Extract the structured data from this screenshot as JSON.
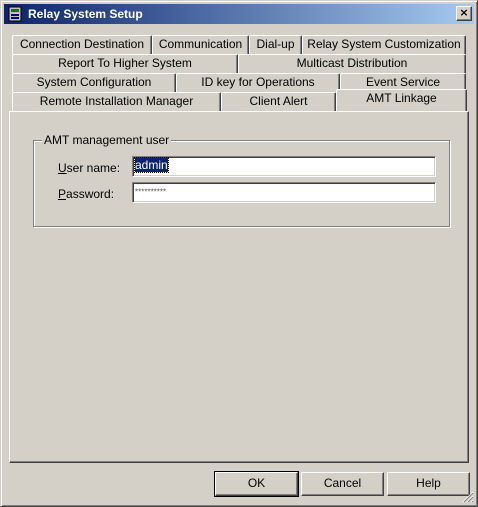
{
  "window": {
    "title": "Relay System Setup",
    "close_label": "×"
  },
  "tabs": {
    "row1": [
      "Connection Destination",
      "Communication",
      "Dial-up",
      "Relay System Customization"
    ],
    "row2": [
      "Report To Higher System",
      "Multicast Distribution"
    ],
    "row3": [
      "System Configuration",
      "ID key for Operations",
      "Event Service"
    ],
    "row4": [
      "Remote Installation Manager",
      "Client Alert",
      "AMT Linkage"
    ],
    "active": "AMT Linkage"
  },
  "group": {
    "legend": "AMT management user",
    "username_label_underlined": "U",
    "username_label_rest": "ser name:",
    "username_value": "admin",
    "password_label_underlined": "P",
    "password_label_rest": "assword:",
    "password_value": "**********"
  },
  "buttons": {
    "ok": "OK",
    "cancel": "Cancel",
    "help": "Help"
  },
  "colors": {
    "title_gradient_start": "#0a246a",
    "title_gradient_end": "#a6caf0",
    "face": "#d4d0c8",
    "selection": "#0a246a"
  },
  "icons": {
    "app": "relay-app-icon",
    "close": "close-icon",
    "grip": "size-grip-icon"
  }
}
